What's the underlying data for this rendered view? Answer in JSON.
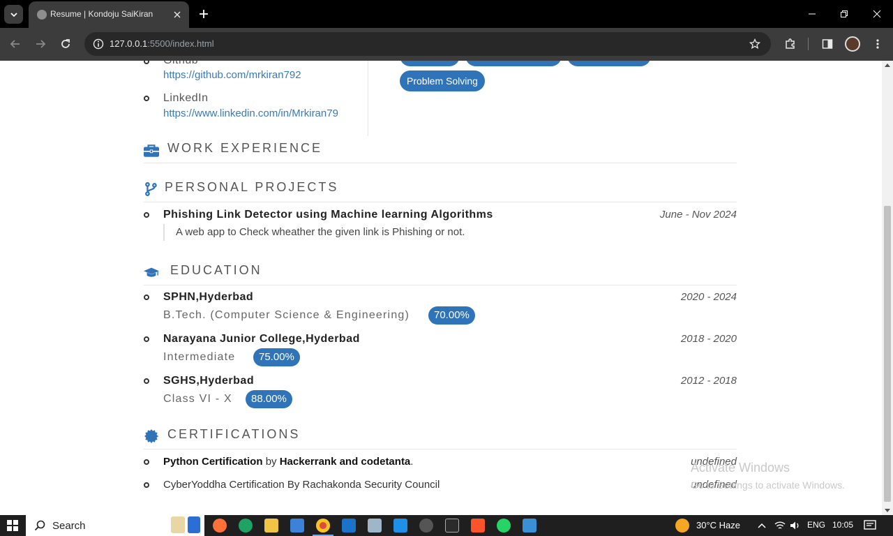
{
  "browser": {
    "tab_title": "Resume | Kondoju SaiKiran",
    "url_host": "127.0.0.1",
    "url_rest": ":5500/index.html"
  },
  "contacts": [
    {
      "label": "Github",
      "url": "https://github.com/mrkiran792"
    },
    {
      "label": "LinkedIn",
      "url": "https://www.linkedin.com/in/Mrkiran79"
    }
  ],
  "skills": {
    "visible_tag": "Problem Solving"
  },
  "sections": {
    "work": "WORK EXPERIENCE",
    "projects": "PERSONAL PROJECTS",
    "education": "EDUCATION",
    "certifications": "CERTIFICATIONS"
  },
  "projects": [
    {
      "title": "Phishing Link Detector using Machine learning Algorithms",
      "date": "June - Nov 2024",
      "description": "A web app to Check wheather the given link is Phishing or not."
    }
  ],
  "education": [
    {
      "school": "SPHN,Hyderbad",
      "date": "2020 - 2024",
      "degree": "B.Tech. (Computer Science & Engineering)",
      "score": "70.00%"
    },
    {
      "school": "Narayana Junior College,Hyderbad",
      "date": "2018 - 2020",
      "degree": "Intermediate",
      "score": "75.00%"
    },
    {
      "school": "SGHS,Hyderbad",
      "date": "2012 - 2018",
      "degree": "Class VI - X",
      "score": "88.00%"
    }
  ],
  "certifications": [
    {
      "name": "Python Certification",
      "by": "by",
      "issuer": "Hackerrank and codetanta",
      "suffix": ".",
      "date": "undefined"
    },
    {
      "text": "CyberYoddha Certification By Rachakonda Security Council",
      "date": "undefined"
    }
  ],
  "watermark": {
    "line1": "Activate Windows",
    "line2": "Go to Settings to activate Windows."
  },
  "taskbar": {
    "search_label": "Search",
    "weather": "30°C  Haze",
    "language": "ENG",
    "time": "10:05"
  },
  "colors": {
    "accent": "#2f73b8",
    "link": "#3b7ab6"
  }
}
